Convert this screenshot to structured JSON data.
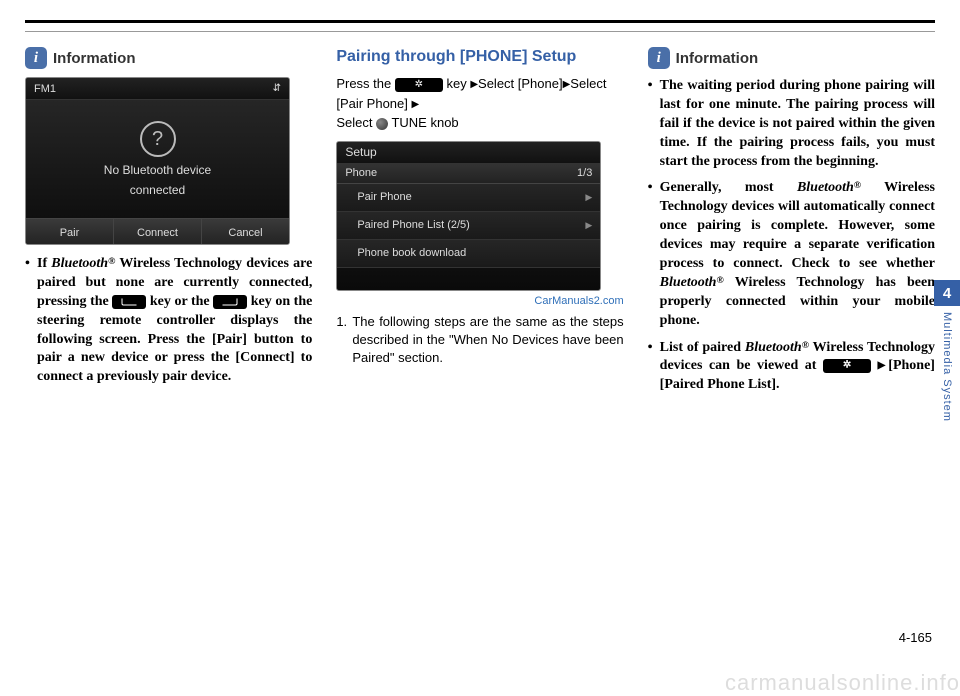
{
  "tab": {
    "number": "4",
    "label": "Multimedia System"
  },
  "page_number": "4-165",
  "footer_watermark": "carmanualsonline.info",
  "watermark": "CarManuals2.com",
  "col1": {
    "info_title": "Information",
    "screen": {
      "topbar_label": "FM1",
      "bt_glyph": "⇵",
      "message_line1": "No Bluetooth device",
      "message_line2": "connected",
      "btn_pair": "Pair",
      "btn_connect": "Connect",
      "btn_cancel": "Cancel"
    },
    "bullet_pre": "If ",
    "bullet_brand": "Bluetooth",
    "bullet_reg": "®",
    "bullet_mid1": " Wireless Technology devices are paired but none are currently connected, pressing the ",
    "bullet_mid2": " key or the ",
    "bullet_mid3": " key on the steering remote controller displays the following screen. Press the [Pair] button to pair a new device or press the [Connect] to connect a previously pair device."
  },
  "col2": {
    "heading": "Pairing through [PHONE] Setup",
    "instr_pre": "Press the ",
    "instr_key": " key ",
    "instr_sel1": "Select [Phone]",
    "instr_sel2": "Select [Pair Phone] ",
    "instr_sel3": "Select ",
    "instr_knob": "TUNE knob",
    "screen": {
      "title": "Setup",
      "hdr": "Phone",
      "frac": "1/3",
      "row1": "Pair Phone",
      "row2": "Paired Phone List  (2/5)",
      "row3": "Phone book download"
    },
    "step_num": "1.",
    "step_body": "The following steps are the same as the steps described in the \"When No Devices have been Paired\" section."
  },
  "col3": {
    "info_title": "Information",
    "b1": "The waiting period during phone pairing will last for one minute. The pairing process will fail if the device is not paired within the given time. If the pairing process fails, you must start the process from the beginning.",
    "b2_pre": "Generally, most ",
    "b2_brand": "Bluetooth",
    "b2_reg": "®",
    "b2_mid": " Wireless Technology devices will automatically connect once pairing is complete. However, some devices may require a separate verification process to connect. Check to see whether ",
    "b2_brand2": "Bluetooth",
    "b2_reg2": "®",
    "b2_tail": " Wireless Technology has been properly connected within your mobile phone.",
    "b3_pre": "List of paired ",
    "b3_brand": "Bluetooth",
    "b3_reg": "®",
    "b3_mid": " Wireless Technology devices can be viewed at ",
    "b3_tail": "[Phone] [Paired Phone List]."
  }
}
